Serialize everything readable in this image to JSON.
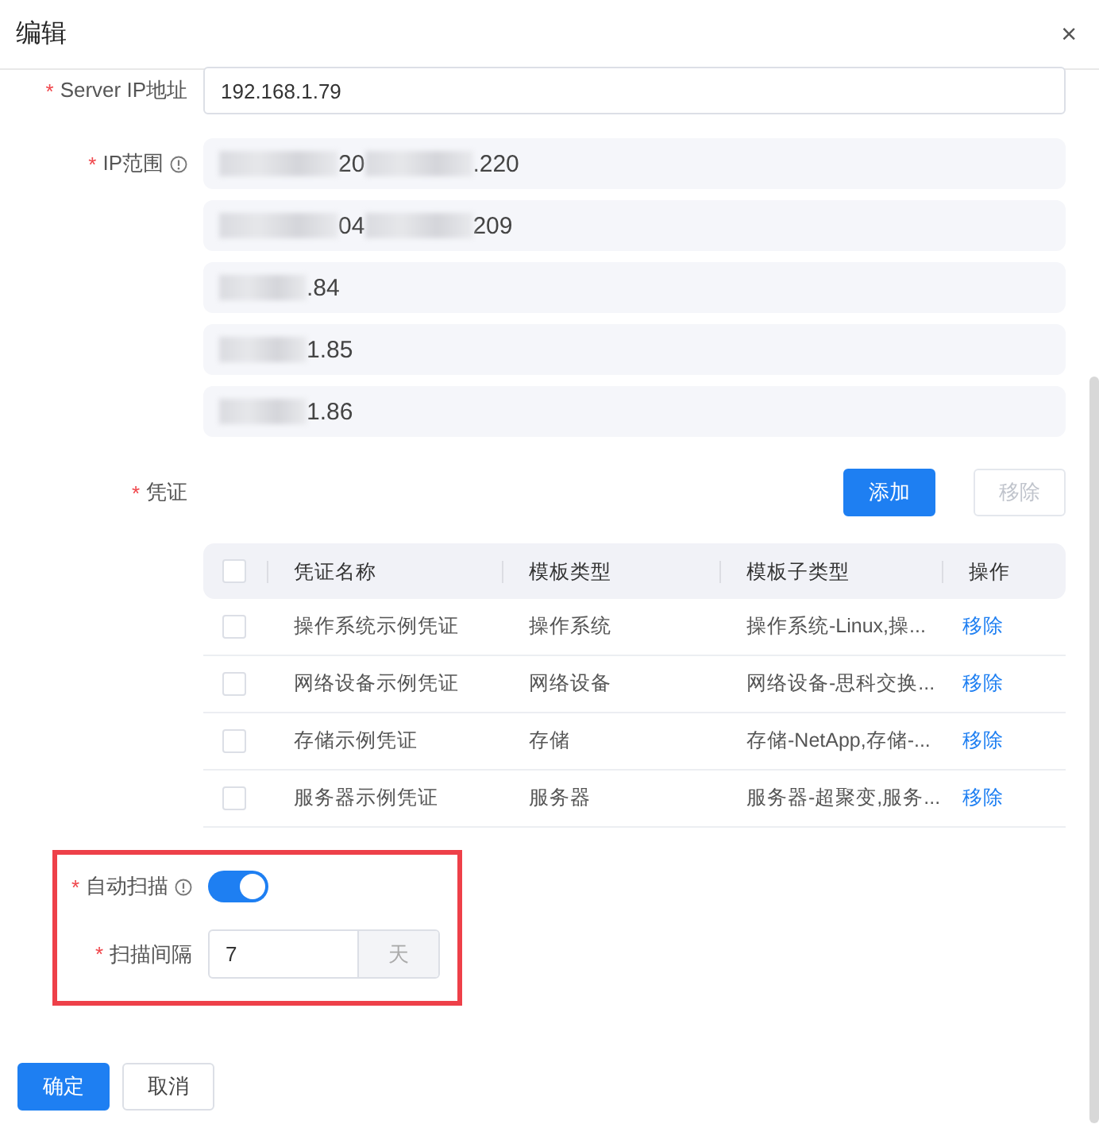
{
  "dialog": {
    "title": "编辑",
    "close": "×"
  },
  "server_ip": {
    "mark": "*",
    "label": "Server IP地址",
    "value": "192.168.1.79"
  },
  "ip_range": {
    "mark": "*",
    "label": "IP范围",
    "info": true,
    "entries": [
      {
        "segments": [
          {
            "kind": "blur"
          },
          {
            "kind": "text",
            "text": "20"
          },
          {
            "kind": "blur"
          },
          {
            "kind": "text",
            "text": ".220"
          }
        ]
      },
      {
        "segments": [
          {
            "kind": "blur"
          },
          {
            "kind": "text",
            "text": "04"
          },
          {
            "kind": "blur"
          },
          {
            "kind": "text",
            "text": "209"
          }
        ]
      },
      {
        "segments": [
          {
            "kind": "blur"
          },
          {
            "kind": "text",
            "text": ".84"
          }
        ]
      },
      {
        "segments": [
          {
            "kind": "blur"
          },
          {
            "kind": "text",
            "text": "1.85"
          }
        ]
      },
      {
        "segments": [
          {
            "kind": "blur"
          },
          {
            "kind": "text",
            "text": "1.86"
          }
        ]
      }
    ]
  },
  "credentials": {
    "mark": "*",
    "label": "凭证",
    "buttons": [
      {
        "label": "添加",
        "kind": "primary",
        "disabled": false
      },
      {
        "label": "移除",
        "kind": "default",
        "disabled": true
      }
    ],
    "table": {
      "all_checked": false,
      "columns": [
        "凭证名称",
        "模板类型",
        "模板子类型",
        "操作"
      ],
      "rows": [
        {
          "checked": false,
          "name": "操作系统示例凭证",
          "type": "操作系统",
          "subtype": "操作系统-Linux,操...",
          "action": "移除"
        },
        {
          "checked": false,
          "name": "网络设备示例凭证",
          "type": "网络设备",
          "subtype": "网络设备-思科交换...",
          "action": "移除"
        },
        {
          "checked": false,
          "name": "存储示例凭证",
          "type": "存储",
          "subtype": "存储-NetApp,存储-...",
          "action": "移除"
        },
        {
          "checked": false,
          "name": "服务器示例凭证",
          "type": "服务器",
          "subtype": "服务器-超聚变,服务...",
          "action": "移除"
        }
      ]
    }
  },
  "auto_scan": {
    "mark": "*",
    "label": "自动扫描",
    "info": true,
    "on": true
  },
  "scan_interval": {
    "mark": "*",
    "label": "扫描间隔",
    "value": "7",
    "unit": "天"
  },
  "footer": {
    "buttons": [
      {
        "label": "确定",
        "kind": "primary",
        "disabled": false
      },
      {
        "label": "取消",
        "kind": "default",
        "disabled": false
      }
    ]
  }
}
